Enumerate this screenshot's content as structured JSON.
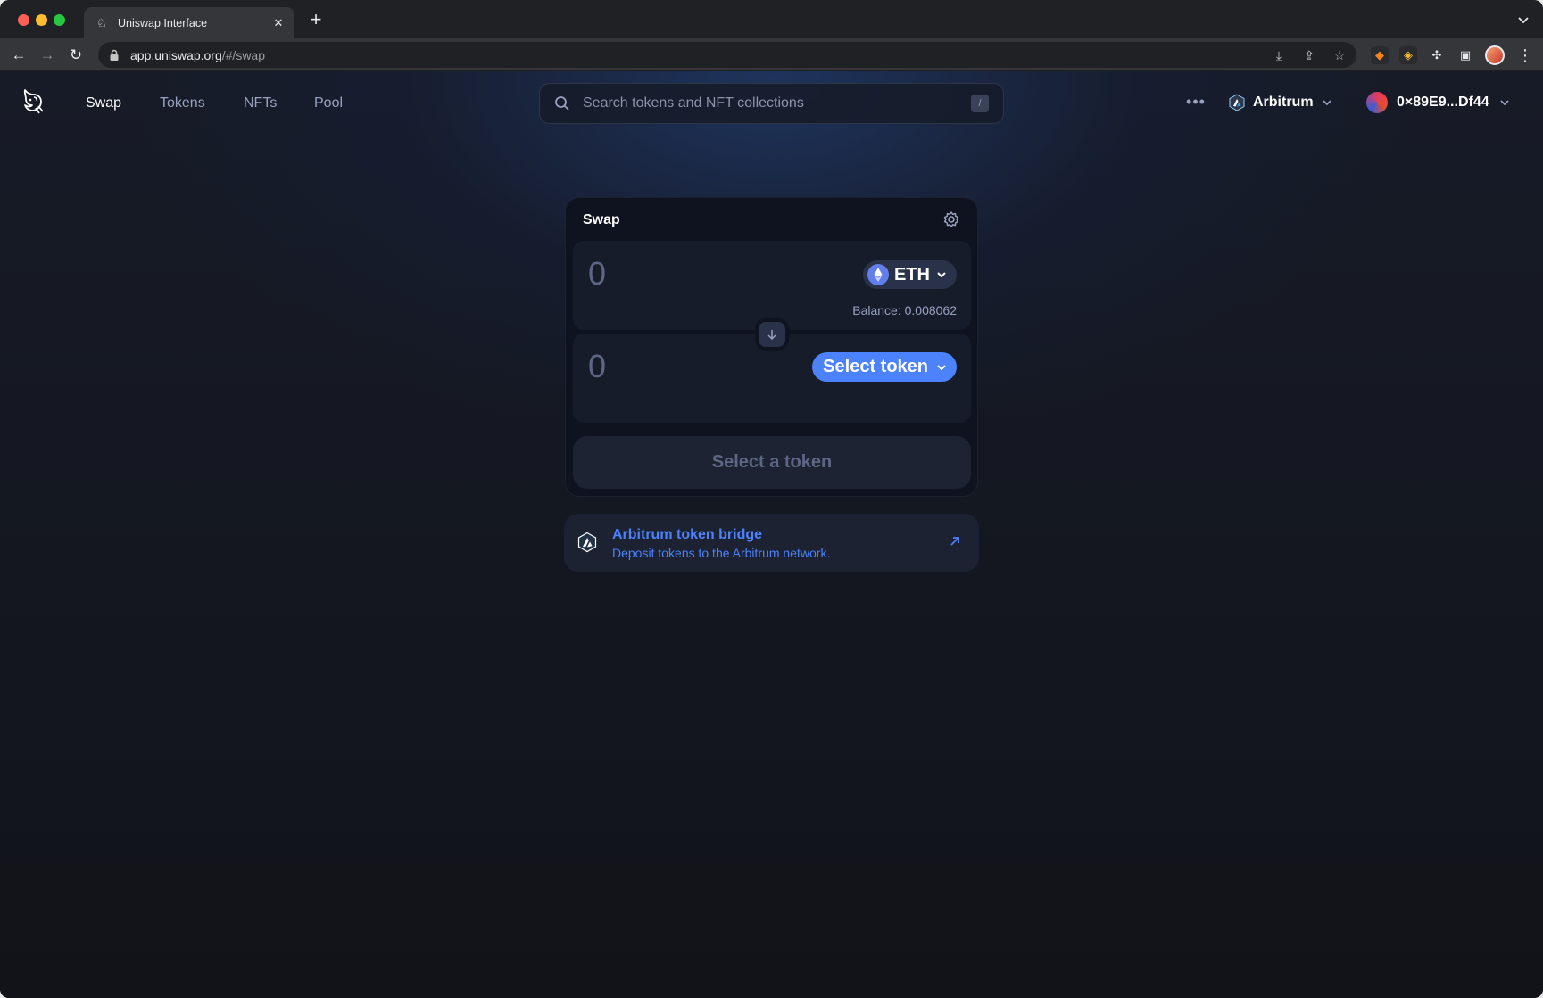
{
  "browser": {
    "tab_title": "Uniswap Interface",
    "url_host": "app.uniswap.org",
    "url_path": "/#/swap"
  },
  "nav": {
    "links": [
      "Swap",
      "Tokens",
      "NFTs",
      "Pool"
    ],
    "active": "Swap",
    "search_placeholder": "Search tokens and NFT collections",
    "search_shortcut": "/",
    "network_label": "Arbitrum",
    "account_label": "0×89E9...Df44"
  },
  "swap": {
    "title": "Swap",
    "input_amount": "0",
    "input_token": "ETH",
    "balance_text": "Balance: 0.008062",
    "output_amount": "0",
    "select_token_label": "Select token",
    "cta_label": "Select a token"
  },
  "bridge": {
    "title": "Arbitrum token bridge",
    "subtitle": "Deposit tokens to the Arbitrum network."
  },
  "colors": {
    "accent": "#4c82fb",
    "eth": "#627eea",
    "muted_text": "#98a1c0"
  }
}
